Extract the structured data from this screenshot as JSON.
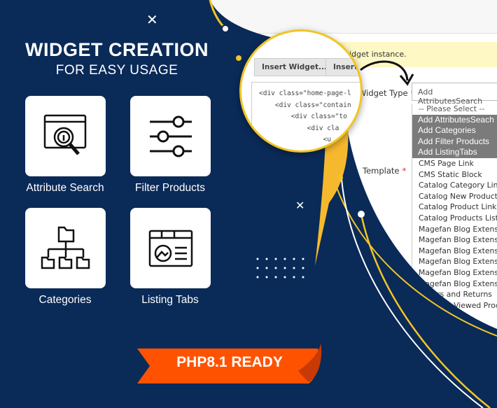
{
  "promo": {
    "title": "WIDGET CREATION",
    "subtitle": "FOR EASY USAGE",
    "badge": "PHP8.1 READY",
    "features": [
      {
        "label": "Attribute Search",
        "icon": "attribute-search-icon"
      },
      {
        "label": "Filter Products",
        "icon": "sliders-icon"
      },
      {
        "label": "Categories",
        "icon": "category-tree-icon"
      },
      {
        "label": "Listing Tabs",
        "icon": "listing-tabs-icon"
      }
    ]
  },
  "admin": {
    "notice": "widget instance.",
    "buttons": [
      "Insert Widget...",
      "Insert"
    ],
    "code_lines": [
      "<div class=\"home-page-l",
      "    <div class=\"contain",
      "        <div class=\"to",
      "            <div cla",
      "                <u"
    ],
    "widget_type_label": "Widget Type",
    "template_label": "Template",
    "widget_type_value": "Add AttributesSearch",
    "options": {
      "placeholder": "-- Please Select --",
      "highlighted": [
        "Add AttributesSeach",
        "Add Categories",
        "Add Filter Products",
        "Add ListingTabs"
      ],
      "others": [
        "CMS Page Link",
        "CMS Static Block",
        "Catalog Category Link",
        "Catalog New Products List",
        "Catalog Product Link",
        "Catalog Products List",
        "Magefan Blog Extension",
        "Magefan Blog Extension",
        "Magefan Blog Extension",
        "Magefan Blog Extension",
        "Magefan Blog Extension",
        "Magefan Blog Extension",
        "Orders and Returns",
        "Recently Viewed Products"
      ]
    }
  },
  "colors": {
    "navy": "#0a2a58",
    "yellow": "#f2c524",
    "orange": "#ff5200",
    "highlight": "#7b7b7b"
  }
}
